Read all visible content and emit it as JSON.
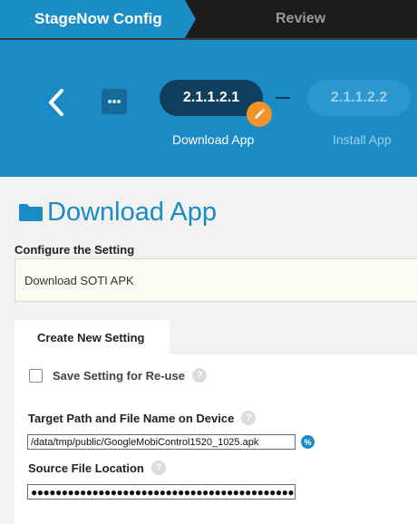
{
  "breadcrumb": {
    "config_label": "StageNow Config",
    "review_label": "Review"
  },
  "steps": {
    "active": {
      "number": "2.1.1.2.1",
      "caption": "Download App"
    },
    "next": {
      "number": "2.1.1.2.2",
      "caption": "Install App"
    }
  },
  "icons": {
    "back": "chevron-left-icon",
    "more": "ellipsis-icon",
    "edit": "pencil-icon",
    "folder": "folder-icon",
    "help": "question-icon",
    "variable": "percent-icon"
  },
  "page": {
    "title": "Download App",
    "configure_label": "Configure the Setting",
    "configure_value": "Download SOTI APK"
  },
  "tabs": {
    "create_label": "Create New Setting"
  },
  "form": {
    "save_label": "Save Setting for Re-use",
    "save_checked": false,
    "help_glyph": "?",
    "variable_glyph": "%",
    "target_label": "Target Path and File Name on Device",
    "target_value": "/data/tmp/public/GoogleMobiControl1520_1025.apk",
    "source_label": "Source File Location",
    "source_value": "●●●●●●●●●●●●●●●●●●●●●●●●●●●●●●●●●●●●●●●●●●●●●●●●●●"
  },
  "colors": {
    "primary": "#1b8bc6",
    "dark_step": "#0e3f5c",
    "accent": "#f0932a",
    "topbar": "#1b1b1b"
  }
}
